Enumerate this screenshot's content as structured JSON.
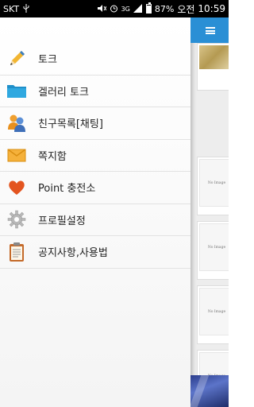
{
  "status_bar": {
    "carrier": "SKT",
    "network": "3G",
    "battery": "87%",
    "ampm": "오전",
    "time": "10:59",
    "battery_level": 0.87
  },
  "drawer": {
    "items": [
      {
        "label": "토크",
        "icon": "pencil-icon"
      },
      {
        "label": "겔러리 토크",
        "icon": "folder-icon"
      },
      {
        "label": "친구목록[채팅]",
        "icon": "people-icon"
      },
      {
        "label": "쪽지함",
        "icon": "envelope-icon"
      },
      {
        "label": "Point 충전소",
        "icon": "heart-icon"
      },
      {
        "label": "프로필설정",
        "icon": "gear-icon"
      },
      {
        "label": "공지사항,사용법",
        "icon": "clipboard-icon"
      }
    ]
  },
  "content": {
    "no_image_label": "No Image",
    "accent_color": "#2a8fd5"
  }
}
